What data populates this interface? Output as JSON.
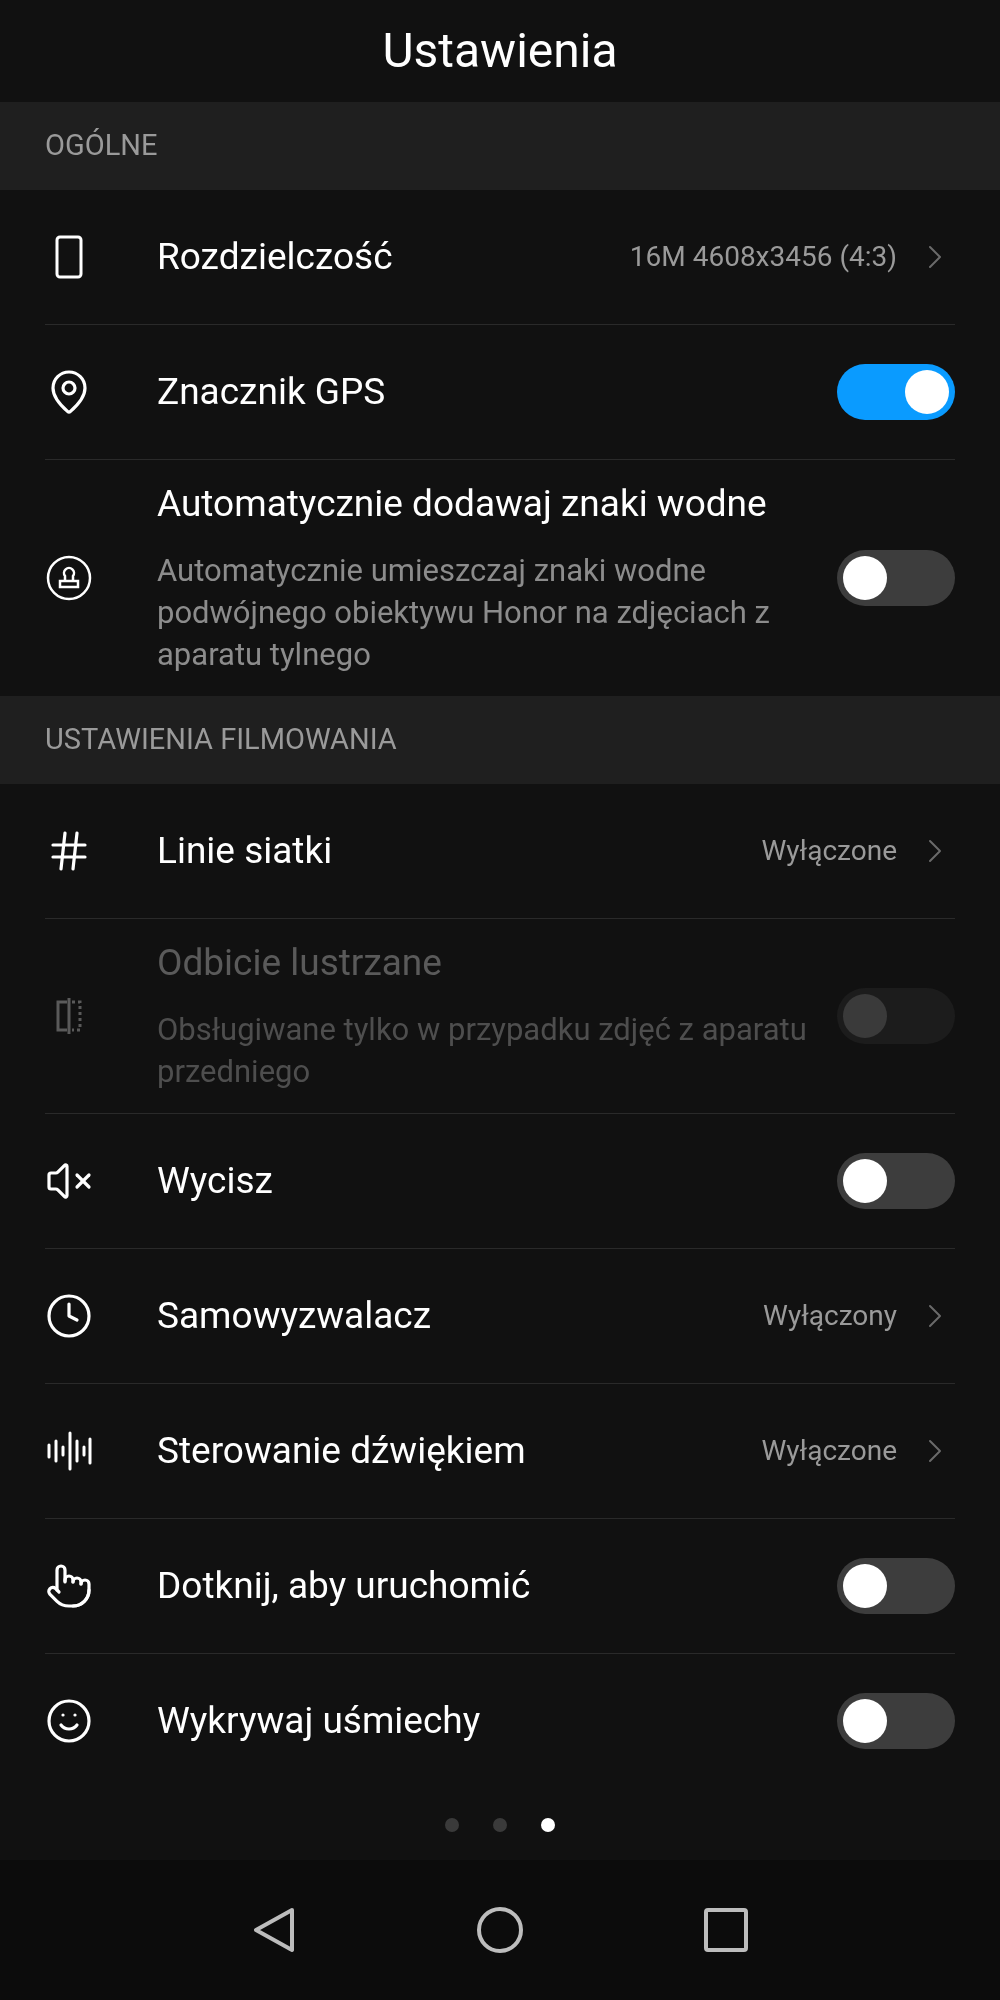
{
  "title": "Ustawienia",
  "sections": [
    {
      "header": "OGÓLNE",
      "items": [
        {
          "kind": "value",
          "label": "Rozdzielczość",
          "value": "16M 4608x3456 (4:3)",
          "disabled": false
        },
        {
          "kind": "toggle",
          "label": "Znacznik GPS",
          "checked": true,
          "disabled": false
        },
        {
          "kind": "toggle",
          "label": "Automatycznie dodawaj znaki wodne",
          "description": "Automatycznie umieszczaj znaki wodne podwójnego obiektywu Honor na zdjęciach z aparatu tylnego",
          "checked": false,
          "disabled": false
        }
      ]
    },
    {
      "header": "USTAWIENIA FILMOWANIA",
      "items": [
        {
          "kind": "value",
          "label": "Linie siatki",
          "value": "Wyłączone",
          "disabled": false
        },
        {
          "kind": "toggle",
          "label": "Odbicie lustrzane",
          "description": "Obsługiwane tylko w przypadku zdjęć z aparatu przedniego",
          "checked": false,
          "disabled": true
        },
        {
          "kind": "toggle",
          "label": "Wycisz",
          "checked": false,
          "disabled": false
        },
        {
          "kind": "value",
          "label": "Samowyzwalacz",
          "value": "Wyłączony",
          "disabled": false
        },
        {
          "kind": "value",
          "label": "Sterowanie dźwiękiem",
          "value": "Wyłączone",
          "disabled": false
        },
        {
          "kind": "toggle",
          "label": "Dotknij, aby uruchomić",
          "checked": false,
          "disabled": false
        },
        {
          "kind": "toggle",
          "label": "Wykrywaj uśmiechy",
          "checked": false,
          "disabled": false
        }
      ]
    }
  ],
  "page_indicator": [
    {
      "selected": false
    },
    {
      "selected": false
    },
    {
      "selected": true
    }
  ]
}
